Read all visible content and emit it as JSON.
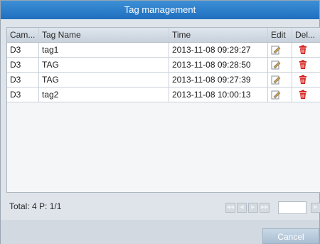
{
  "dialog": {
    "title": "Tag management"
  },
  "table": {
    "headers": [
      "Cam...",
      "Tag Name",
      "Time",
      "Edit",
      "Del..."
    ],
    "rows": [
      {
        "camera": "D3",
        "tag": "tag1",
        "time": "2013-11-08 09:29:27",
        "edit_icon": "edit-icon",
        "delete_icon": "trash-icon"
      },
      {
        "camera": "D3",
        "tag": "TAG",
        "time": "2013-11-08 09:28:50",
        "edit_icon": "edit-icon",
        "delete_icon": "trash-icon"
      },
      {
        "camera": "D3",
        "tag": "TAG",
        "time": "2013-11-08 09:27:39",
        "edit_icon": "edit-icon",
        "delete_icon": "trash-icon"
      },
      {
        "camera": "D3",
        "tag": "tag2",
        "time": "2013-11-08 10:00:13",
        "edit_icon": "edit-icon",
        "delete_icon": "trash-icon"
      }
    ]
  },
  "footer": {
    "total_label": "Total: 4 P: 1/1",
    "pager_icons": [
      "first-page-icon",
      "prev-page-icon",
      "next-page-icon",
      "last-page-icon",
      "go-page-icon"
    ],
    "page_input_value": ""
  },
  "actions": {
    "cancel_label": "Cancel"
  },
  "colors": {
    "title_bar": "#2a7dcb",
    "delete_icon": "#d4201c",
    "background": "#dfe4ea"
  }
}
